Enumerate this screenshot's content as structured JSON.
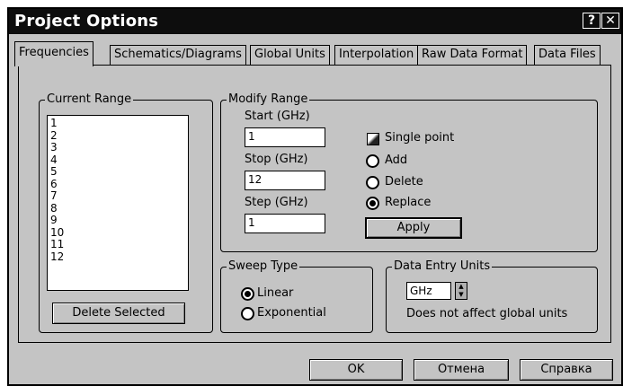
{
  "window": {
    "title": "Project Options",
    "help_glyph": "?",
    "close_glyph": "✕"
  },
  "tabs": [
    {
      "label": "Frequencies",
      "active": true
    },
    {
      "label": "Schematics/Diagrams",
      "active": false
    },
    {
      "label": "Global Units",
      "active": false
    },
    {
      "label": "Interpolation",
      "active": false
    },
    {
      "label": "Raw Data Format",
      "active": false
    },
    {
      "label": "Data Files",
      "active": false
    }
  ],
  "current_range": {
    "label": "Current Range",
    "items": [
      "1",
      "2",
      "3",
      "4",
      "5",
      "6",
      "7",
      "8",
      "9",
      "10",
      "11",
      "12"
    ],
    "delete_button": "Delete Selected"
  },
  "modify_range": {
    "label": "Modify Range",
    "start_label": "Start (GHz)",
    "start_value": "1",
    "stop_label": "Stop (GHz)",
    "stop_value": "12",
    "step_label": "Step (GHz)",
    "step_value": "1",
    "single_point_label": "Single point",
    "add_label": "Add",
    "delete_label": "Delete",
    "replace_label": "Replace",
    "selected_option": "Replace",
    "apply_button": "Apply"
  },
  "sweep_type": {
    "label": "Sweep Type",
    "linear_label": "Linear",
    "exponential_label": "Exponential",
    "selected": "Linear"
  },
  "data_entry_units": {
    "label": "Data Entry Units",
    "value": "GHz",
    "note": "Does not affect global units"
  },
  "footer": {
    "ok": "OK",
    "cancel": "Отмена",
    "help": "Справка"
  }
}
